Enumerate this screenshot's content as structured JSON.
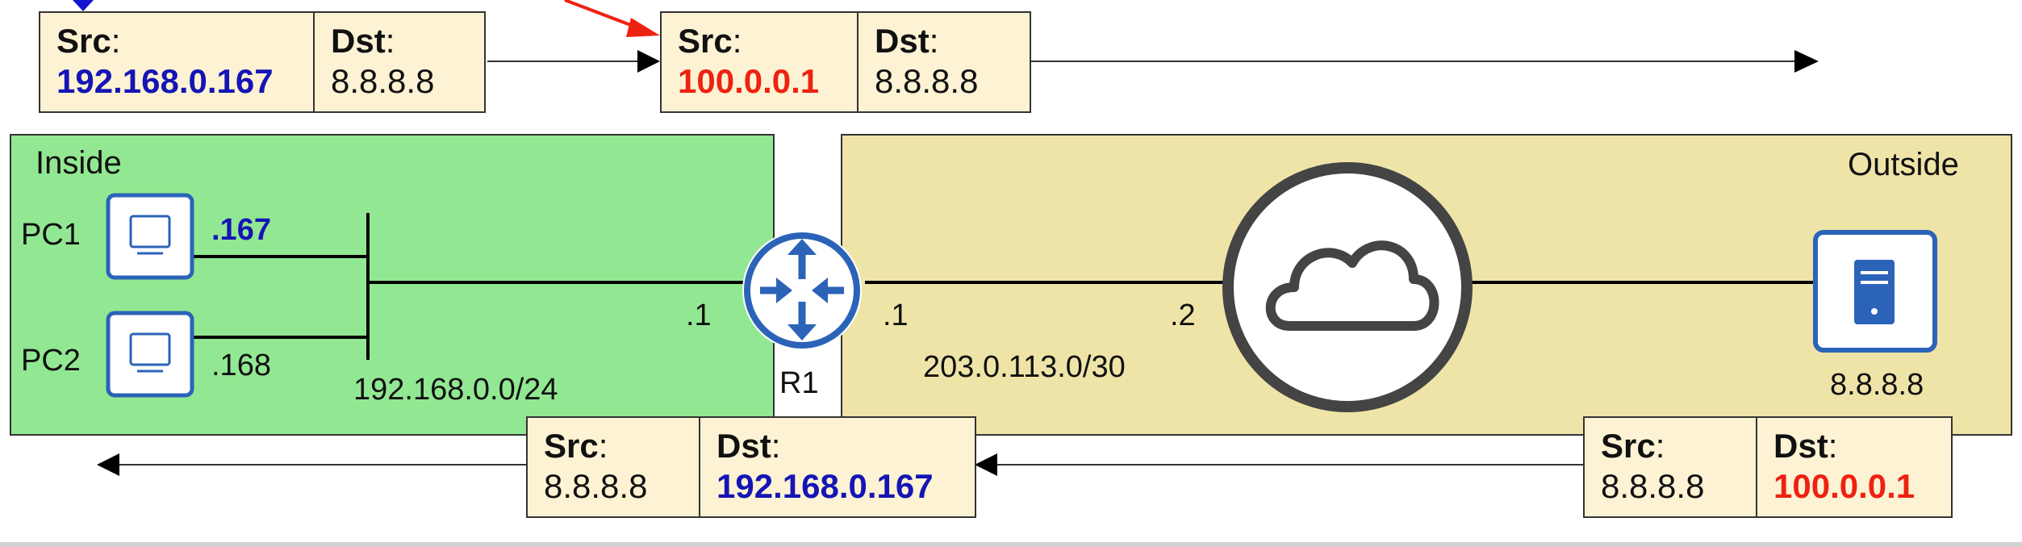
{
  "zones": {
    "inside": {
      "label": "Inside"
    },
    "outside": {
      "label": "Outside"
    }
  },
  "devices": {
    "pc1": {
      "name": "PC1",
      "addr": ".167"
    },
    "pc2": {
      "name": "PC2",
      "addr": ".168"
    },
    "r1": {
      "name": "R1",
      "inside_addr": ".1",
      "outside_addr": ".1"
    },
    "isp": {
      "addr": ".2"
    },
    "server": {
      "addr": "8.8.8.8"
    }
  },
  "networks": {
    "inside_subnet": "192.168.0.0/24",
    "outside_subnet": "203.0.113.0/30"
  },
  "packets": {
    "top_before": {
      "src_key": "Src",
      "dst_key": "Dst",
      "src": "192.168.0.167",
      "dst": "8.8.8.8"
    },
    "top_after": {
      "src_key": "Src",
      "dst_key": "Dst",
      "src": "100.0.0.1",
      "dst": "8.8.8.8"
    },
    "bottom_before": {
      "src_key": "Src",
      "dst_key": "Dst",
      "src": "8.8.8.8",
      "dst": "100.0.0.1"
    },
    "bottom_after": {
      "src_key": "Src",
      "dst_key": "Dst",
      "src": "8.8.8.8",
      "dst": "192.168.0.167"
    }
  },
  "colors": {
    "inside_ip": "#1515b5",
    "translated_ip": "#ee2211",
    "device_blue": "#2b63b8"
  },
  "icons": {
    "pc": "monitor-icon",
    "router": "router-icon",
    "cloud": "cloud-icon",
    "server": "server-icon"
  }
}
